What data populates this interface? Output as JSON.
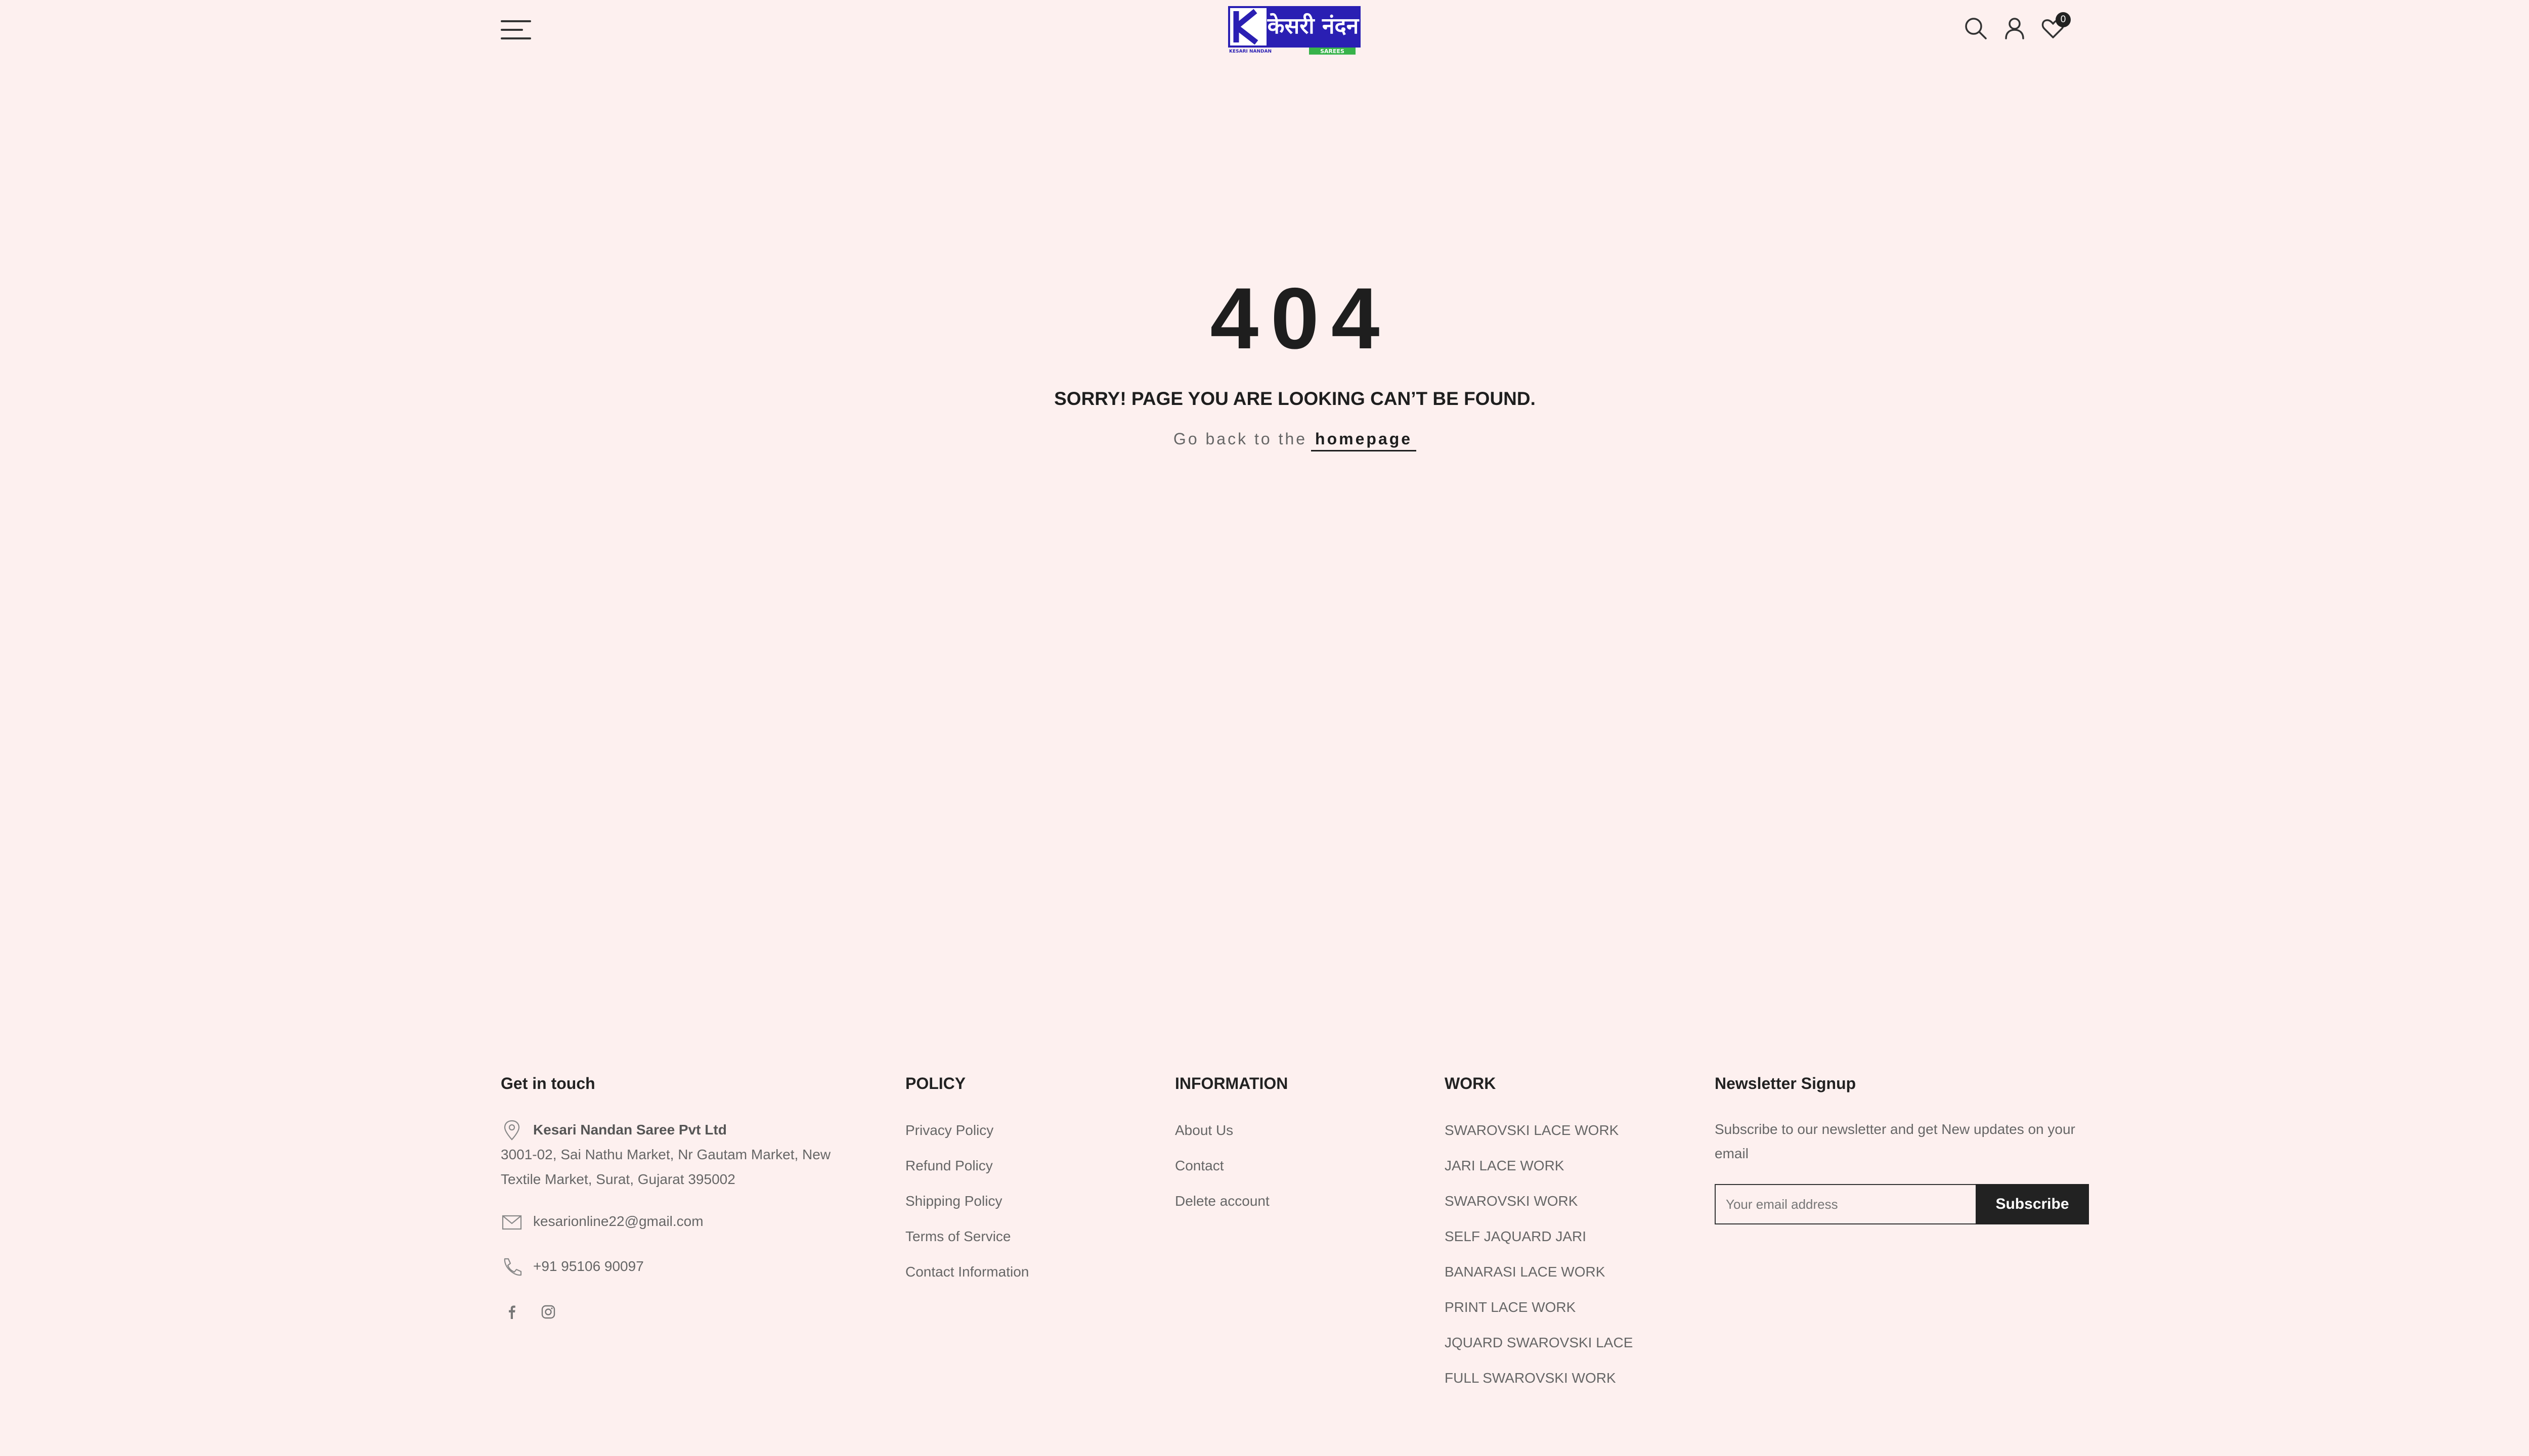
{
  "header": {
    "logo": {
      "brand_text": "केसरी नंदन",
      "small_text": "KESARI NANDAN",
      "tag_text": "SAREES",
      "brand_color": "#2a1fb3",
      "tag_color": "#37b34a"
    },
    "cart_count": "0"
  },
  "error": {
    "code": "404",
    "message": "SORRY! PAGE YOU ARE LOOKING CAN’T BE FOUND.",
    "back_prefix": "Go back to the",
    "back_link": "homepage"
  },
  "footer": {
    "contact": {
      "heading": "Get in touch",
      "company": "Kesari Nandan Saree Pvt Ltd",
      "address_line1": "3001-02, Sai Nathu Market, Nr Gautam Market, New",
      "address_line2": "Textile Market, Surat, Gujarat 395002",
      "email": "kesarionline22@gmail.com",
      "phone": "+91 95106 90097"
    },
    "policy": {
      "heading": "POLICY",
      "links": [
        "Privacy Policy",
        "Refund Policy",
        "Shipping Policy",
        "Terms of Service",
        "Contact Information"
      ]
    },
    "information": {
      "heading": "INFORMATION",
      "links": [
        "About Us",
        "Contact",
        "Delete account"
      ]
    },
    "work": {
      "heading": "WORK",
      "links": [
        "SWAROVSKI LACE WORK",
        "JARI LACE WORK",
        "SWAROVSKI WORK",
        "SELF JAQUARD JARI",
        "BANARASI LACE WORK",
        "PRINT LACE WORK",
        "JQUARD SWAROVSKI LACE",
        "FULL SWAROVSKI WORK"
      ]
    },
    "newsletter": {
      "heading": "Newsletter Signup",
      "description": "Subscribe to our newsletter and get New updates on your email",
      "placeholder": "Your email address",
      "button": "Subscribe"
    }
  }
}
